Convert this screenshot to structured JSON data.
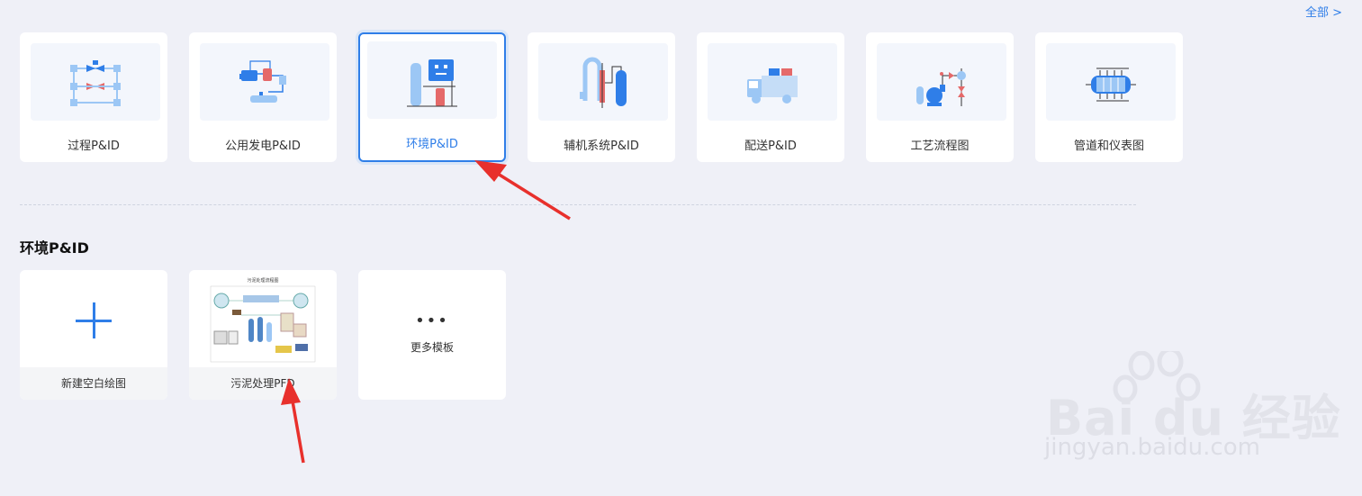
{
  "header": {
    "all_link": "全部 >"
  },
  "categories": [
    {
      "label": "过程P&ID",
      "icon": "process-pid-icon"
    },
    {
      "label": "公用发电P&ID",
      "icon": "power-generation-pid-icon"
    },
    {
      "label": "环境P&ID",
      "icon": "environment-pid-icon",
      "selected": true
    },
    {
      "label": "辅机系统P&ID",
      "icon": "auxiliary-system-pid-icon"
    },
    {
      "label": "配送P&ID",
      "icon": "delivery-truck-icon"
    },
    {
      "label": "工艺流程图",
      "icon": "process-flow-icon"
    },
    {
      "label": "管道和仪表图",
      "icon": "piping-instrument-icon"
    }
  ],
  "section": {
    "title": "环境P&ID"
  },
  "templates": [
    {
      "label": "新建空白绘图",
      "icon": "plus-icon"
    },
    {
      "label": "污泥处理PFD",
      "preview_title": "污泥处理流程图"
    }
  ],
  "more": {
    "dots": "•••",
    "label": "更多模板"
  },
  "watermark": {
    "brand": "Bai du 经验",
    "sub": "jingyan.baidu.com"
  },
  "colors": {
    "accent": "#2f7ee8",
    "background": "#eff0f7",
    "annotation": "#e8302c"
  }
}
